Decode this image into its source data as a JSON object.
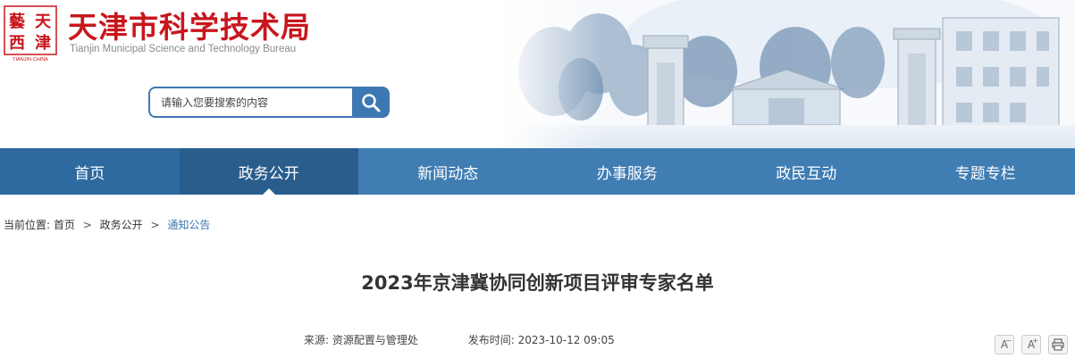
{
  "site": {
    "title": "天津市科学技术局",
    "subtitle": "Tianjin Municipal Science and Technology Bureau",
    "logo_text": [
      "天",
      "津",
      "藝",
      "西"
    ]
  },
  "search": {
    "placeholder": "请输入您要搜索的内容"
  },
  "nav": {
    "items": [
      {
        "label": "首页"
      },
      {
        "label": "政务公开"
      },
      {
        "label": "新闻动态"
      },
      {
        "label": "办事服务"
      },
      {
        "label": "政民互动"
      },
      {
        "label": "专题专栏"
      }
    ]
  },
  "breadcrumb": {
    "prefix": "当前位置:",
    "items": [
      "首页",
      "政务公开",
      "通知公告"
    ],
    "separator": ">"
  },
  "article": {
    "title": "2023年京津冀协同创新项目评审专家名单",
    "source_label": "来源:",
    "source": "资源配置与管理处",
    "time_label": "发布时间:",
    "time": "2023-10-12 09:05"
  },
  "tools": {
    "font_smaller": "A",
    "font_larger": "A"
  },
  "colors": {
    "brand_red": "#c8161d",
    "nav_blue": "#3f7db3",
    "nav_active": "#2a5d8c",
    "link_blue": "#3e78b2"
  }
}
